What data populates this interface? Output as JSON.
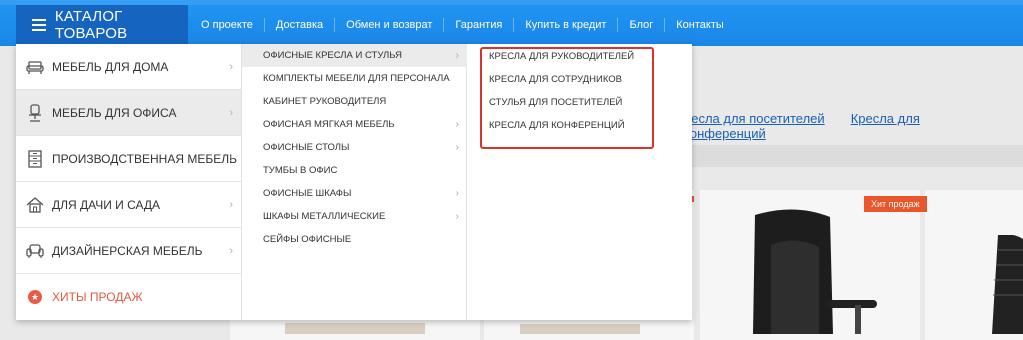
{
  "header": {
    "catalog_label": "КАТАЛОГ ТОВАРОВ",
    "nav": [
      "О проекте",
      "Доставка",
      "Обмен и возврат",
      "Гарантия",
      "Купить в кредит",
      "Блог",
      "Контакты"
    ]
  },
  "background": {
    "links": [
      "ресла для посетителей",
      "Кресла для конференций"
    ],
    "badge": "Хит продаж"
  },
  "menu": {
    "categories": [
      {
        "label": "МЕБЕЛЬ ДЛЯ ДОМА",
        "icon": "armchair-icon"
      },
      {
        "label": "МЕБЕЛЬ ДЛЯ ОФИСА",
        "icon": "office-chair-icon"
      },
      {
        "label": "ПРОИЗВОДСТВЕННАЯ МЕБЕЛЬ",
        "icon": "cabinet-icon"
      },
      {
        "label": "ДЛЯ ДАЧИ И САДА",
        "icon": "house-icon"
      },
      {
        "label": "ДИЗАЙНЕРСКАЯ МЕБЕЛЬ",
        "icon": "sofa-icon"
      },
      {
        "label": "ХИТЫ ПРОДАЖ",
        "icon": "star-icon"
      }
    ],
    "subcategories": [
      "ОФИСНЫЕ КРЕСЛА И СТУЛЬЯ",
      "КОМПЛЕКТЫ МЕБЕЛИ ДЛЯ ПЕРСОНАЛА",
      "КАБИНЕТ РУКОВОДИТЕЛЯ",
      "ОФИСНАЯ МЯГКАЯ МЕБЕЛЬ",
      "ОФИСНЫЕ СТОЛЫ",
      "ТУМБЫ В ОФИС",
      "ОФИСНЫЕ ШКАФЫ",
      "ШКАФЫ МЕТАЛЛИЧЕСКИЕ",
      "СЕЙФЫ ОФИСНЫЕ"
    ],
    "items": [
      "КРЕСЛА ДЛЯ РУКОВОДИТЕЛЕЙ",
      "КРЕСЛА ДЛЯ СОТРУДНИКОВ",
      "СТУЛЬЯ ДЛЯ ПОСЕТИТЕЛЕЙ",
      "КРЕСЛА ДЛЯ КОНФЕРЕНЦИЙ"
    ]
  },
  "colors": {
    "brand": "#1e88e5",
    "brand_dark": "#1565c0",
    "accent": "#e05a44",
    "highlight": "#d9342b"
  }
}
